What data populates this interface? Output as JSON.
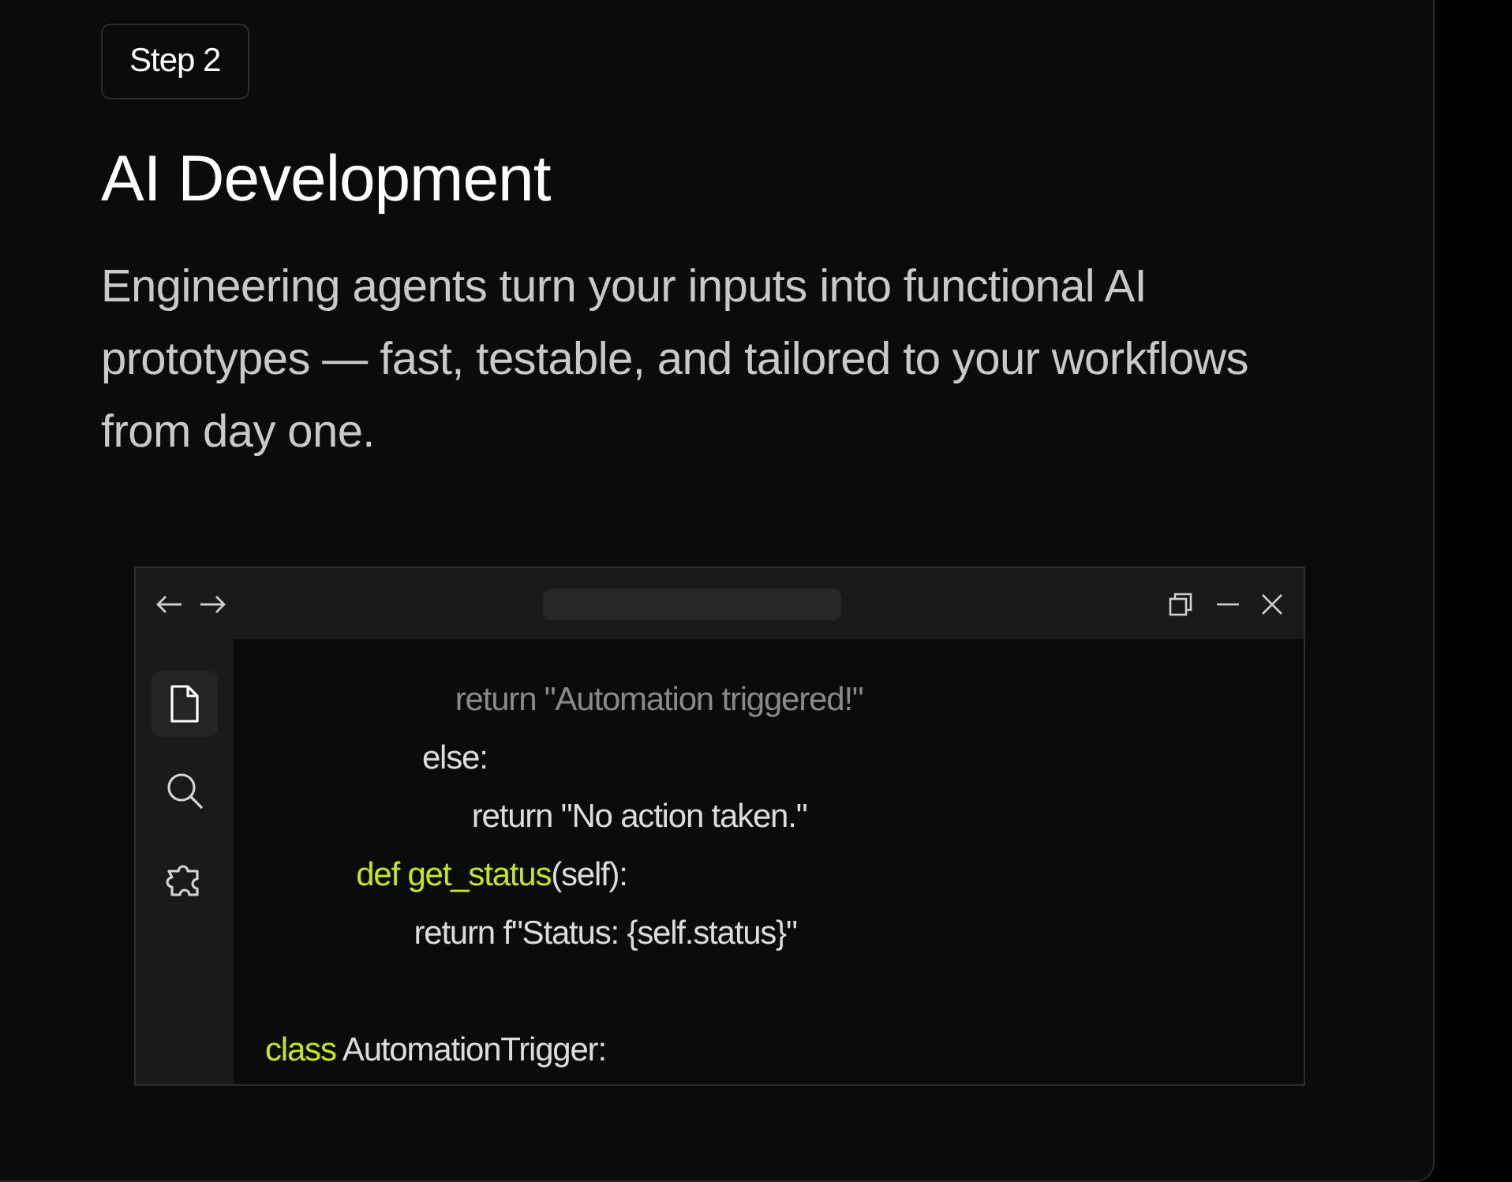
{
  "badge": "Step 2",
  "heading": "AI Development",
  "description": "Engineering agents turn your inputs into functional AI prototypes — fast, testable, and tailored to your workflows from day one.",
  "editor": {
    "sidebar": [
      {
        "kind": "file",
        "selected": true
      },
      {
        "kind": "search",
        "selected": false
      },
      {
        "kind": "extension",
        "selected": false
      }
    ],
    "code": [
      {
        "dimmed": true,
        "segments": [
          {
            "kind": "plain",
            "text": "                       return \"Automation triggered!\""
          }
        ]
      },
      {
        "dimmed": false,
        "segments": [
          {
            "kind": "plain",
            "text": "                   else:"
          }
        ]
      },
      {
        "dimmed": false,
        "segments": [
          {
            "kind": "plain",
            "text": "                         return \"No action taken.\""
          }
        ]
      },
      {
        "dimmed": false,
        "segments": [
          {
            "kind": "keyword",
            "text": "           def get_status"
          },
          {
            "kind": "plain",
            "text": "(self):"
          }
        ]
      },
      {
        "dimmed": false,
        "segments": [
          {
            "kind": "plain",
            "text": "                  return f\"Status: {self.status}\""
          }
        ]
      },
      {
        "kind": "blank"
      },
      {
        "dimmed": false,
        "segments": [
          {
            "kind": "keyword",
            "text": "class"
          },
          {
            "kind": "plain",
            "text": " AutomationTrigger:"
          }
        ]
      }
    ]
  }
}
